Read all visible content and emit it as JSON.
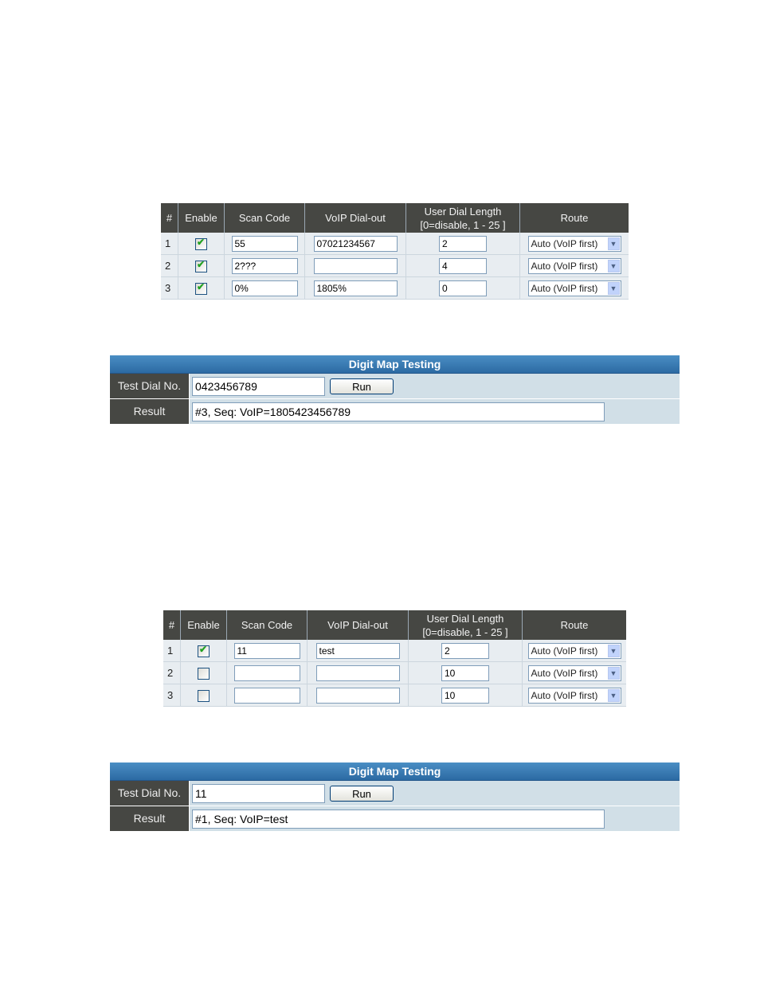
{
  "tables": [
    {
      "headers": [
        "#",
        "Enable",
        "Scan Code",
        "VoIP Dial-out",
        "User Dial Length",
        "[0=disable, 1 - 25 ]",
        "Route"
      ],
      "rows": [
        {
          "num": "1",
          "enabled": true,
          "scan_code": "55",
          "voip_dialout": "07021234567",
          "dial_length": "2",
          "route": "Auto (VoIP first)"
        },
        {
          "num": "2",
          "enabled": true,
          "scan_code": "2???",
          "voip_dialout": "",
          "dial_length": "4",
          "route": "Auto (VoIP first)"
        },
        {
          "num": "3",
          "enabled": true,
          "scan_code": "0%",
          "voip_dialout": "1805%",
          "dial_length": "0",
          "route": "Auto (VoIP first)"
        }
      ]
    },
    {
      "headers": [
        "#",
        "Enable",
        "Scan Code",
        "VoIP Dial-out",
        "User Dial Length",
        "[0=disable, 1 - 25 ]",
        "Route"
      ],
      "rows": [
        {
          "num": "1",
          "enabled": true,
          "scan_code": "11",
          "voip_dialout": "test",
          "dial_length": "2",
          "route": "Auto (VoIP first)"
        },
        {
          "num": "2",
          "enabled": false,
          "scan_code": "",
          "voip_dialout": "",
          "dial_length": "10",
          "route": "Auto (VoIP first)"
        },
        {
          "num": "3",
          "enabled": false,
          "scan_code": "",
          "voip_dialout": "",
          "dial_length": "10",
          "route": "Auto (VoIP first)"
        }
      ]
    }
  ],
  "tests": [
    {
      "title": "Digit Map Testing",
      "dial_label": "Test Dial No.",
      "dial_value": "0423456789",
      "run_label": "Run",
      "result_label": "Result",
      "result_value": "#3, Seq: VoIP=1805423456789"
    },
    {
      "title": "Digit Map Testing",
      "dial_label": "Test Dial No.",
      "dial_value": "11",
      "run_label": "Run",
      "result_label": "Result",
      "result_value": "#1, Seq: VoIP=test"
    }
  ],
  "icons": {
    "check": "✔",
    "dropdown": "▼"
  }
}
